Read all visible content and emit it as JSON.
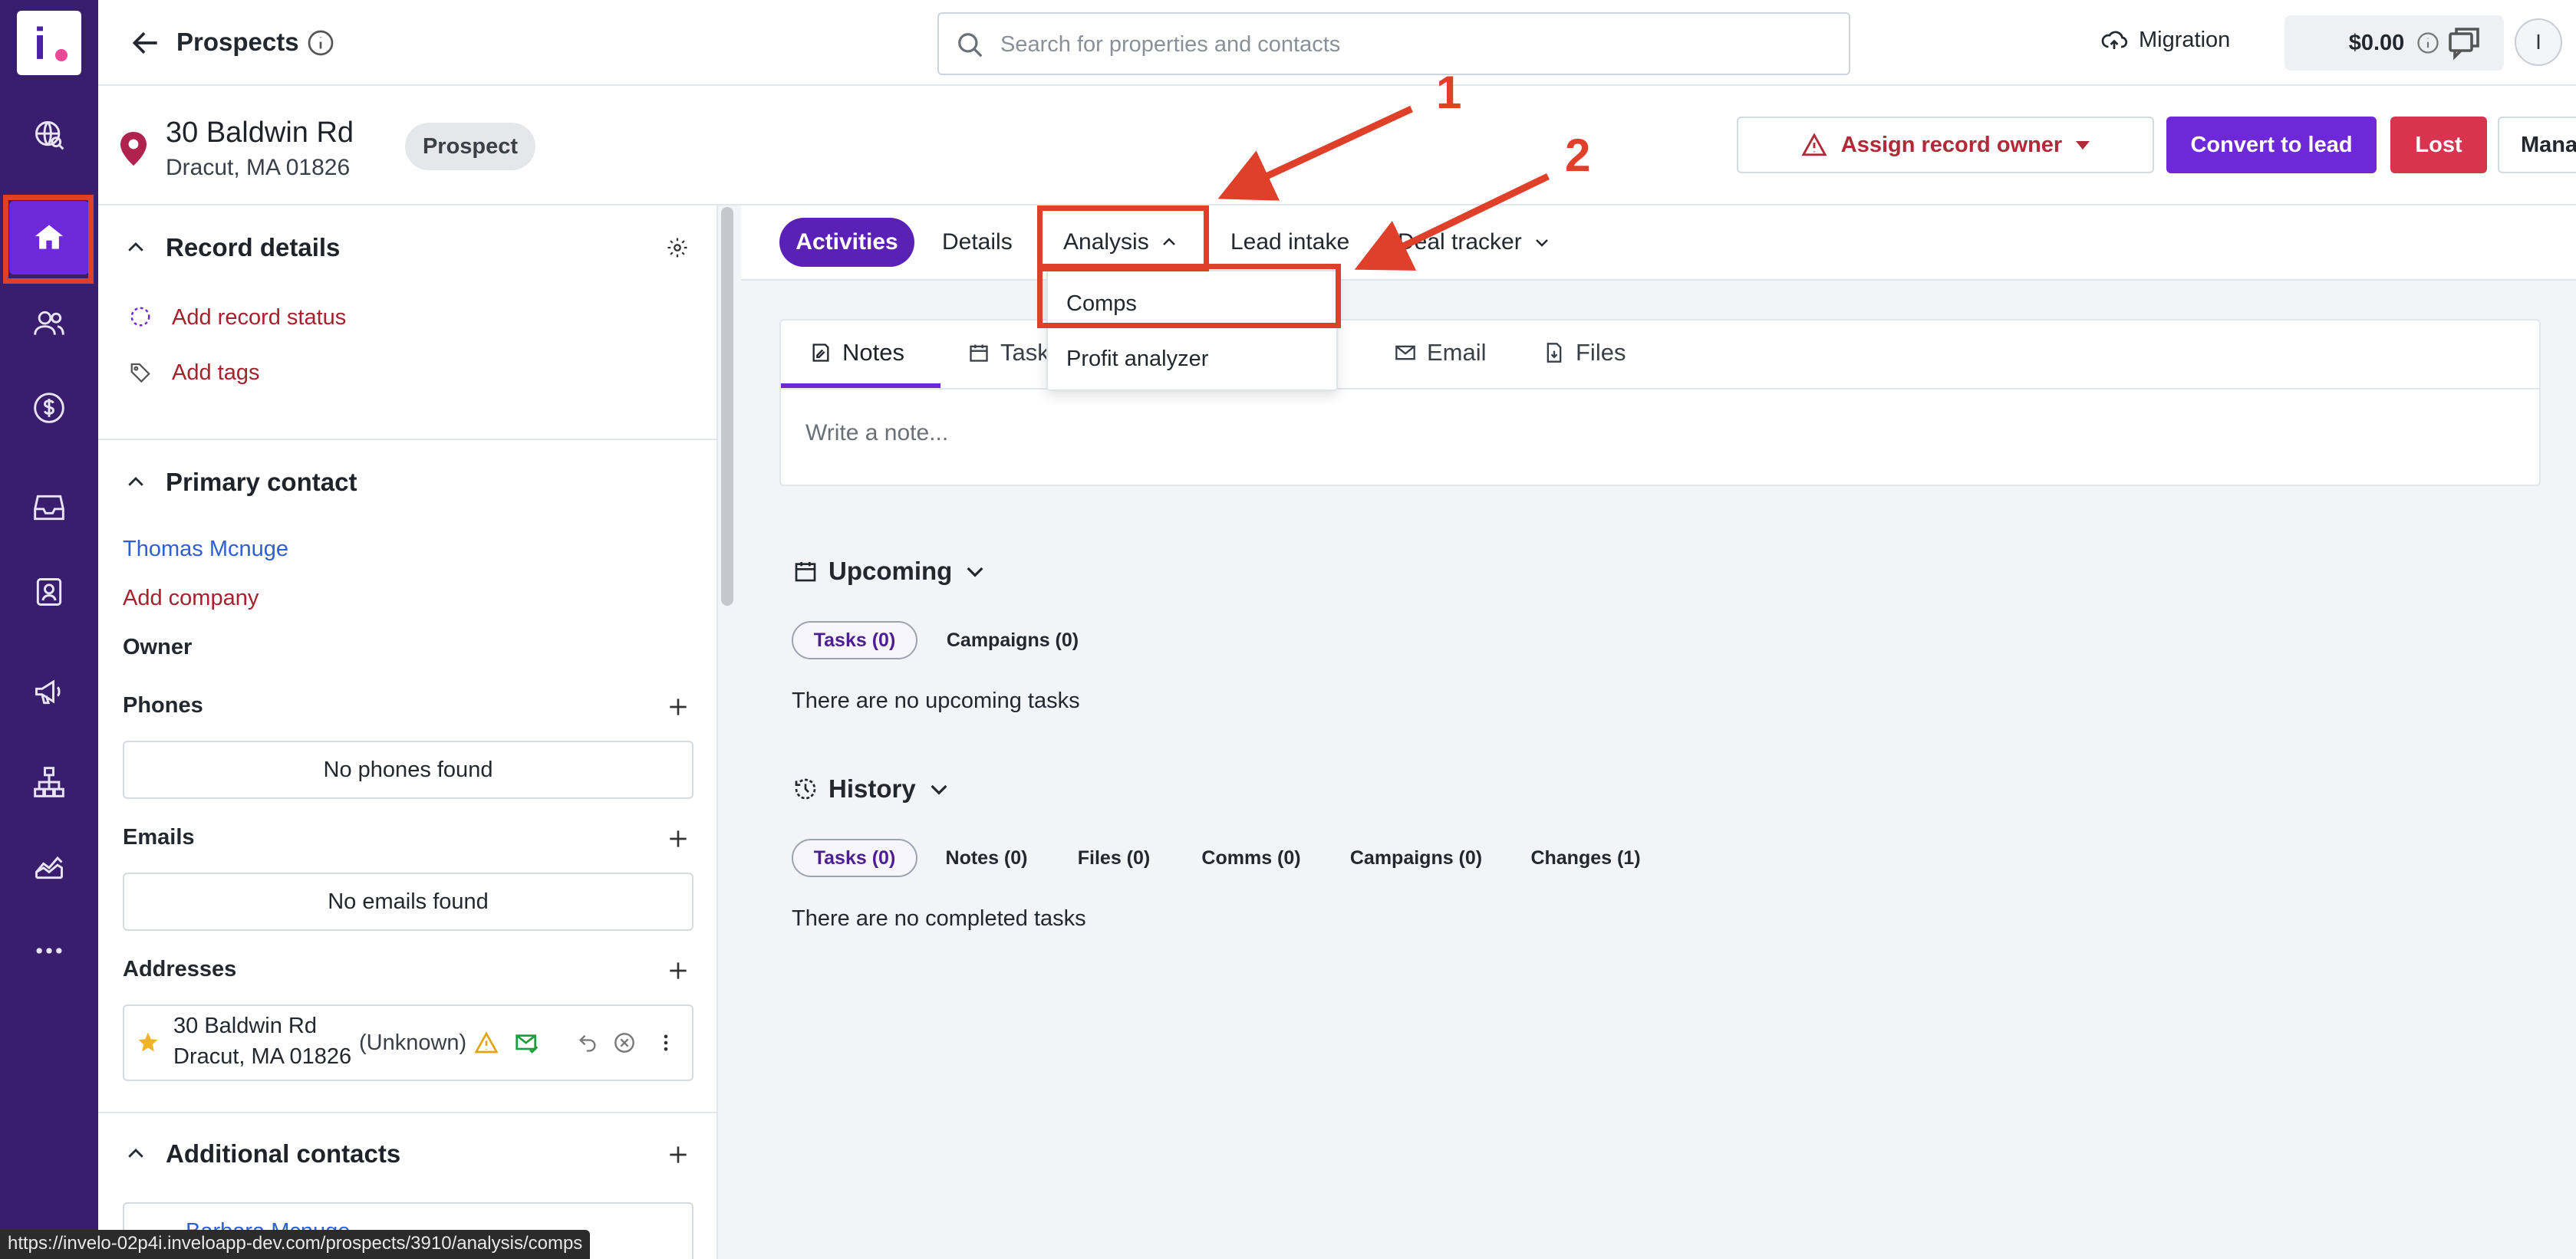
{
  "header": {
    "title": "Prospects",
    "search_placeholder": "Search for properties and contacts",
    "migration_label": "Migration",
    "balance": "$0.00",
    "avatar_initial": "I"
  },
  "record": {
    "address_line1": "30 Baldwin Rd",
    "address_line2": "Dracut, MA 01826",
    "stage": "Prospect",
    "assign_owner_label": "Assign record owner",
    "convert_label": "Convert to lead",
    "lost_label": "Lost",
    "manage_label": "Manage"
  },
  "left_panel": {
    "record_details_title": "Record details",
    "add_status": "Add record status",
    "add_tags": "Add tags",
    "primary_contact_title": "Primary contact",
    "contact_name": "Thomas Mcnuge",
    "add_company": "Add company",
    "owner_label": "Owner",
    "phones_label": "Phones",
    "no_phones": "No phones found",
    "emails_label": "Emails",
    "no_emails": "No emails found",
    "addresses_label": "Addresses",
    "address_item_line1": "30 Baldwin Rd",
    "address_item_line2": "Dracut, MA 01826",
    "address_item_status": "(Unknown)",
    "additional_contacts_title": "Additional contacts",
    "additional_contact_name": "Barbara Mcnuge"
  },
  "tabs": {
    "activities": "Activities",
    "details": "Details",
    "analysis": "Analysis",
    "lead_intake": "Lead intake",
    "deal_tracker": "Deal tracker"
  },
  "analysis_menu": {
    "comps": "Comps",
    "profit_analyzer": "Profit analyzer"
  },
  "activity_tabs": {
    "notes": "Notes",
    "tasks": "Tasks",
    "email": "Email",
    "files": "Files",
    "note_placeholder": "Write a note..."
  },
  "upcoming": {
    "title": "Upcoming",
    "tasks_pill": "Tasks (0)",
    "campaigns_pill": "Campaigns (0)",
    "empty": "There are no upcoming tasks"
  },
  "history": {
    "title": "History",
    "tasks_pill": "Tasks (0)",
    "notes_pill": "Notes (0)",
    "files_pill": "Files (0)",
    "comms_pill": "Comms (0)",
    "campaigns_pill": "Campaigns (0)",
    "changes_pill": "Changes (1)",
    "empty": "There are no completed tasks"
  },
  "annotations": {
    "label1": "1",
    "label2": "2"
  },
  "status_url": "https://invelo-02p4i.inveloapp-dev.com/prospects/3910/analysis/comps",
  "colors": {
    "rail": "#3a1e6e",
    "accent": "#6d28d9",
    "lost": "#d9344f",
    "link_red": "#a5212d",
    "link_blue": "#2f5fd0",
    "annotation": "#e0402a"
  }
}
